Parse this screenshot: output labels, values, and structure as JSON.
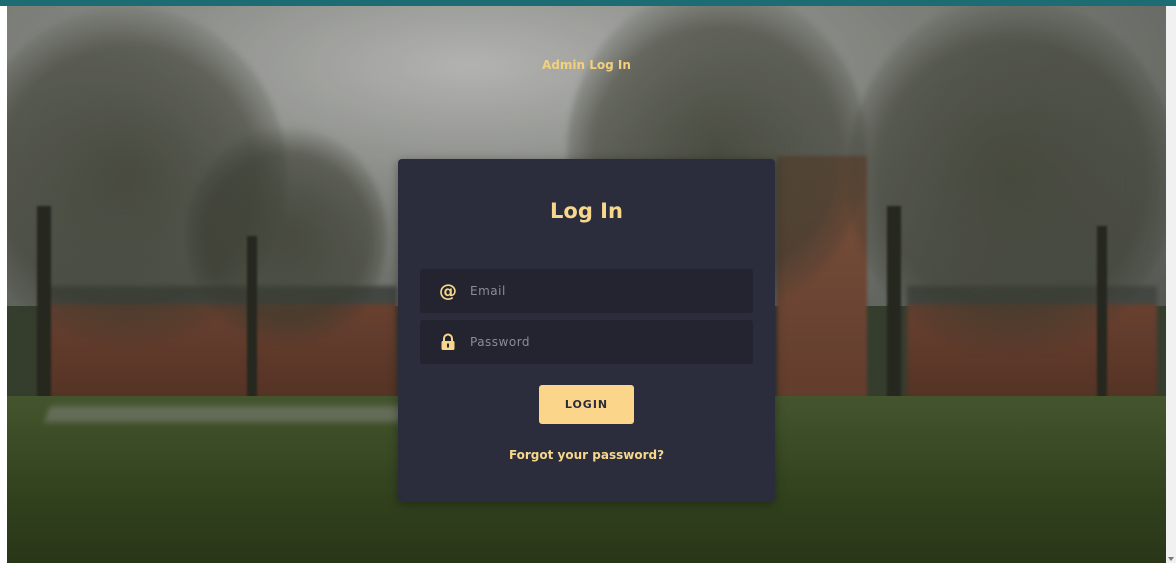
{
  "page": {
    "header_title": "Admin Log In"
  },
  "login_card": {
    "title": "Log In",
    "email": {
      "icon": "at-icon",
      "glyph": "@",
      "placeholder": "Email",
      "value": ""
    },
    "password": {
      "icon": "lock-icon",
      "placeholder": "Password",
      "value": ""
    },
    "submit_label": "LOGIN",
    "forgot_label": "Forgot your password?"
  },
  "colors": {
    "accent": "#f6d78b",
    "button": "#fbd68a",
    "card": "#2b2d3c",
    "field": "#23242f",
    "topbar": "#1b6d73"
  }
}
